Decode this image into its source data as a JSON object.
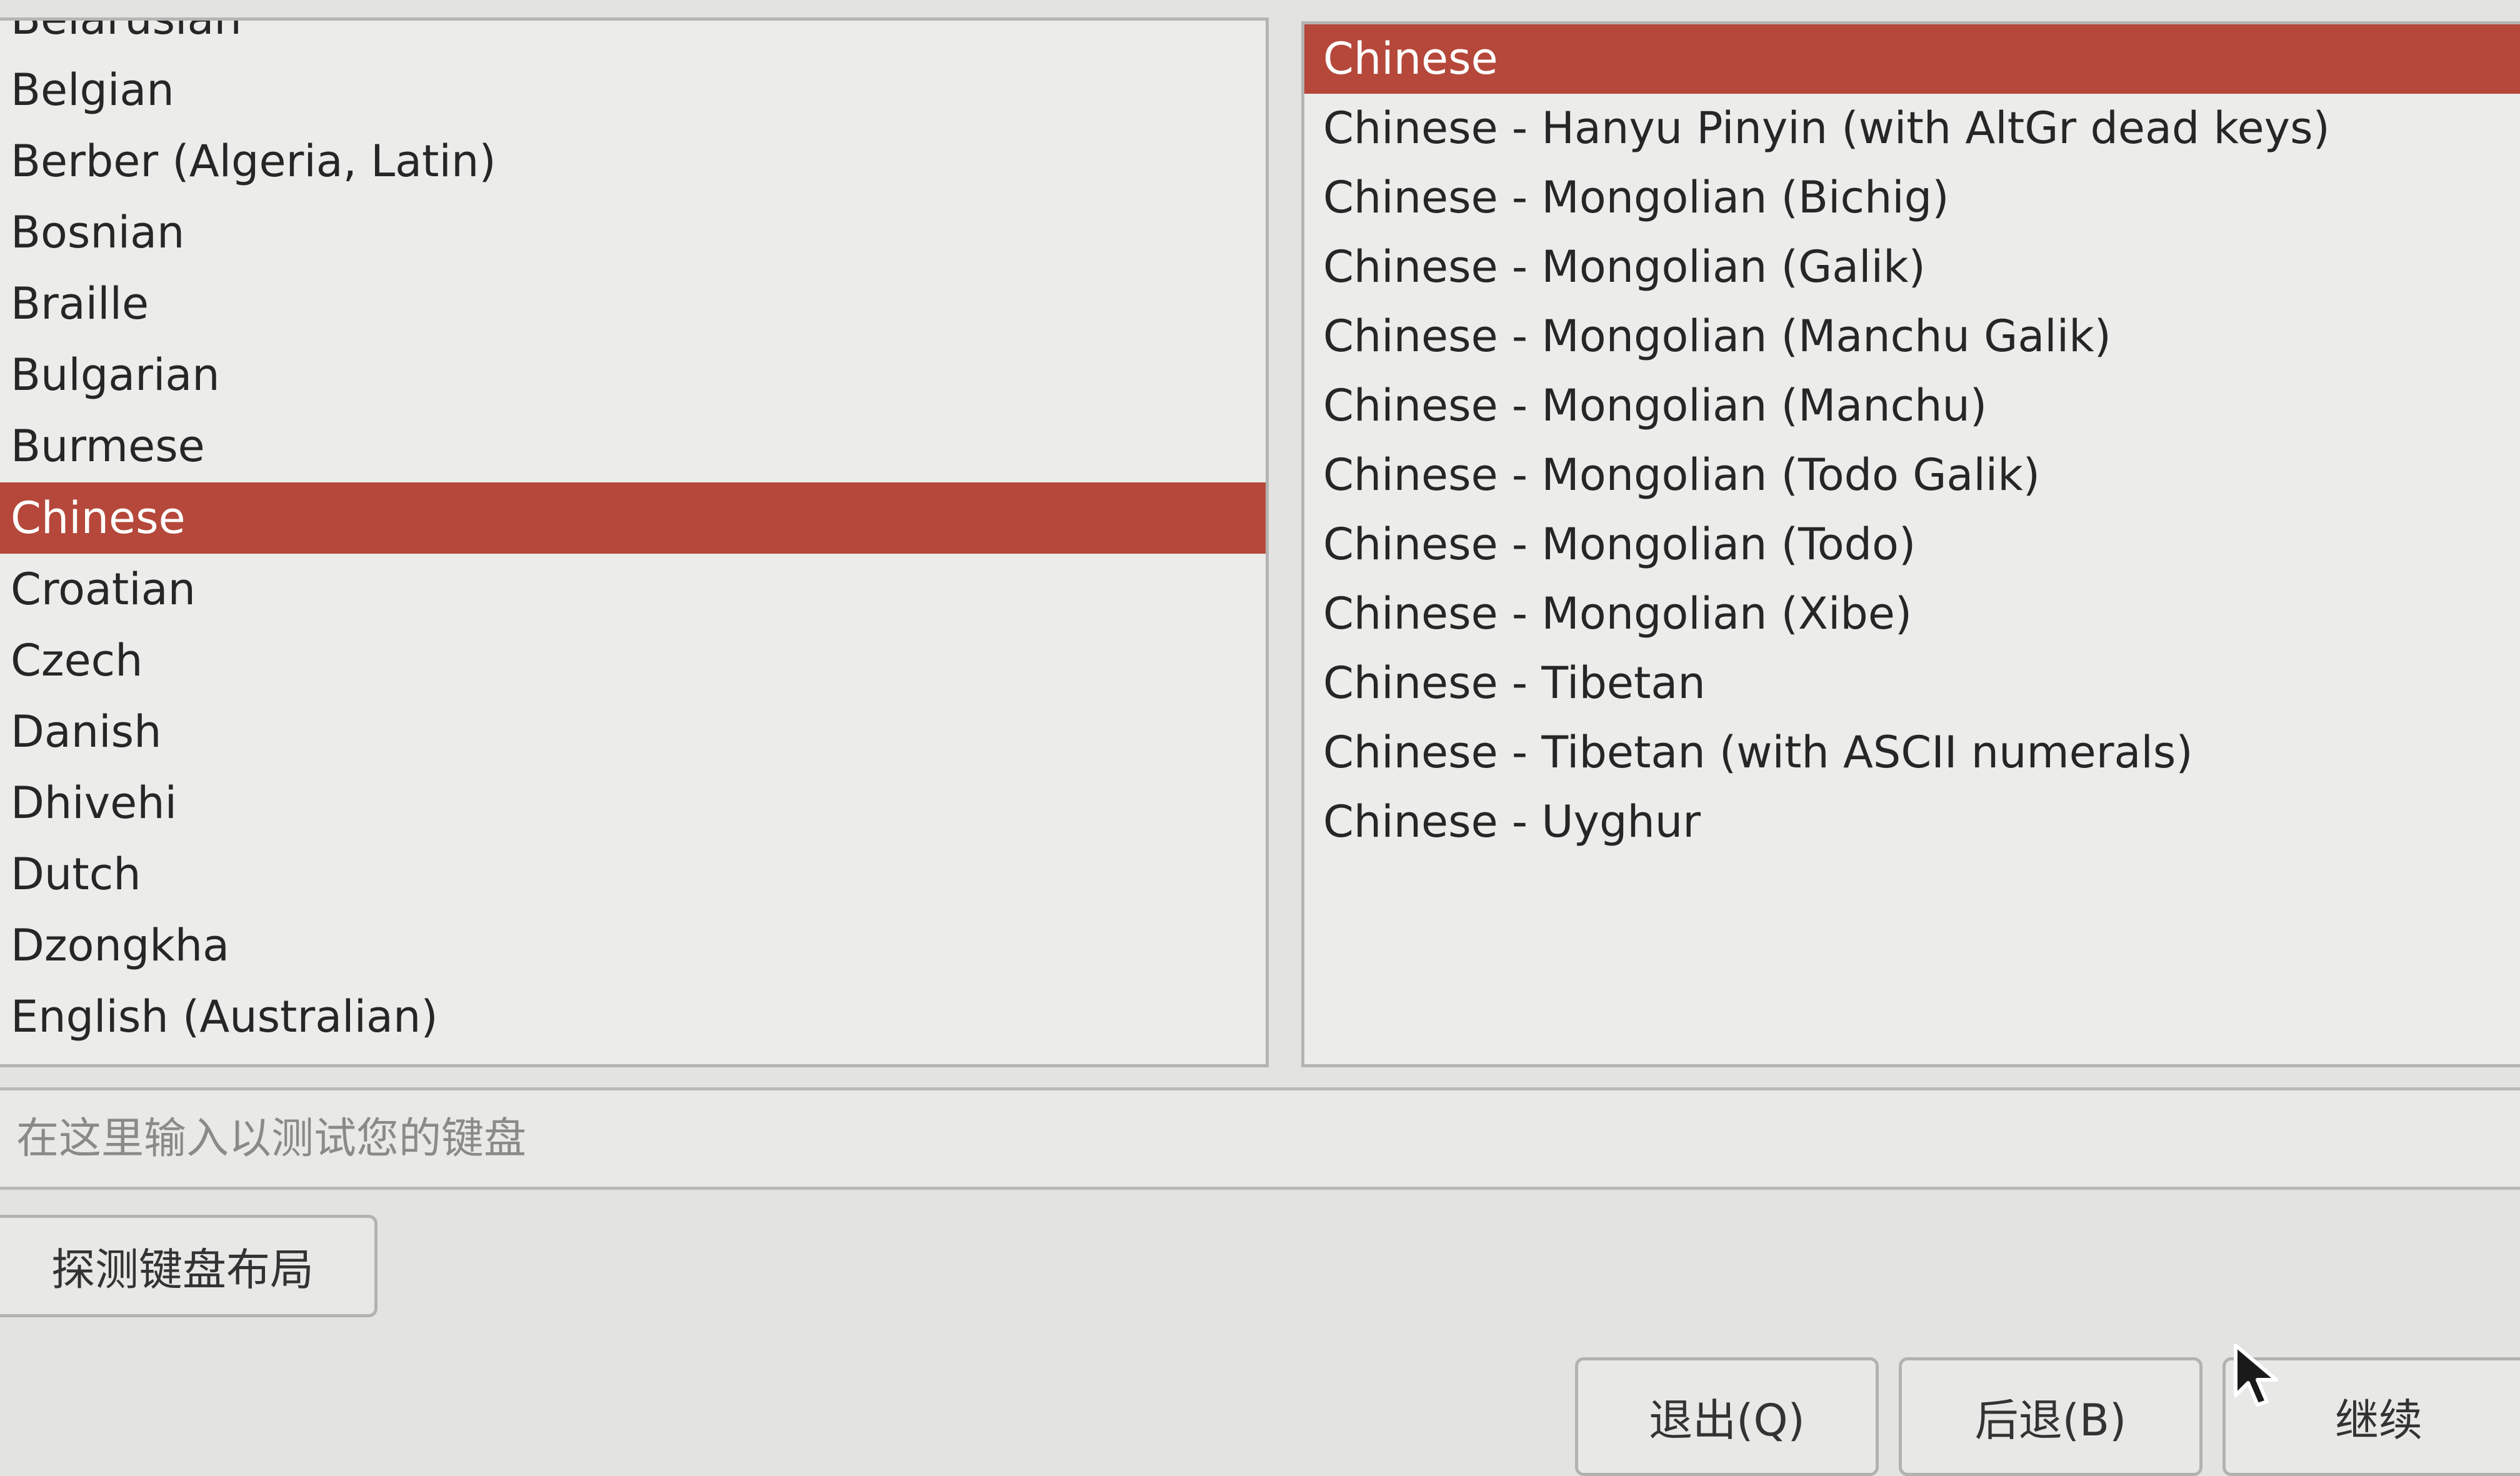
{
  "layout_list": {
    "items": [
      "Belarusian",
      "Belgian",
      "Berber (Algeria, Latin)",
      "Bosnian",
      "Braille",
      "Bulgarian",
      "Burmese",
      "Chinese",
      "Croatian",
      "Czech",
      "Danish",
      "Dhivehi",
      "Dutch",
      "Dzongkha",
      "English (Australian)"
    ],
    "selected": "Chinese"
  },
  "variant_list": {
    "items": [
      "Chinese",
      "Chinese - Hanyu Pinyin (with AltGr dead keys)",
      "Chinese - Mongolian (Bichig)",
      "Chinese - Mongolian (Galik)",
      "Chinese - Mongolian (Manchu Galik)",
      "Chinese - Mongolian (Manchu)",
      "Chinese - Mongolian (Todo Galik)",
      "Chinese - Mongolian (Todo)",
      "Chinese - Mongolian (Xibe)",
      "Chinese - Tibetan",
      "Chinese - Tibetan (with ASCII numerals)",
      "Chinese - Uyghur"
    ],
    "selected": "Chinese"
  },
  "test_field": {
    "placeholder": "在这里输入以测试您的键盘",
    "value": ""
  },
  "buttons": {
    "detect_layout": "探测键盘布局",
    "quit": "退出(Q)",
    "back": "后退(B)",
    "continue": "继续"
  },
  "colors": {
    "selection": "#b5483a",
    "background": "#e3e3e1"
  }
}
